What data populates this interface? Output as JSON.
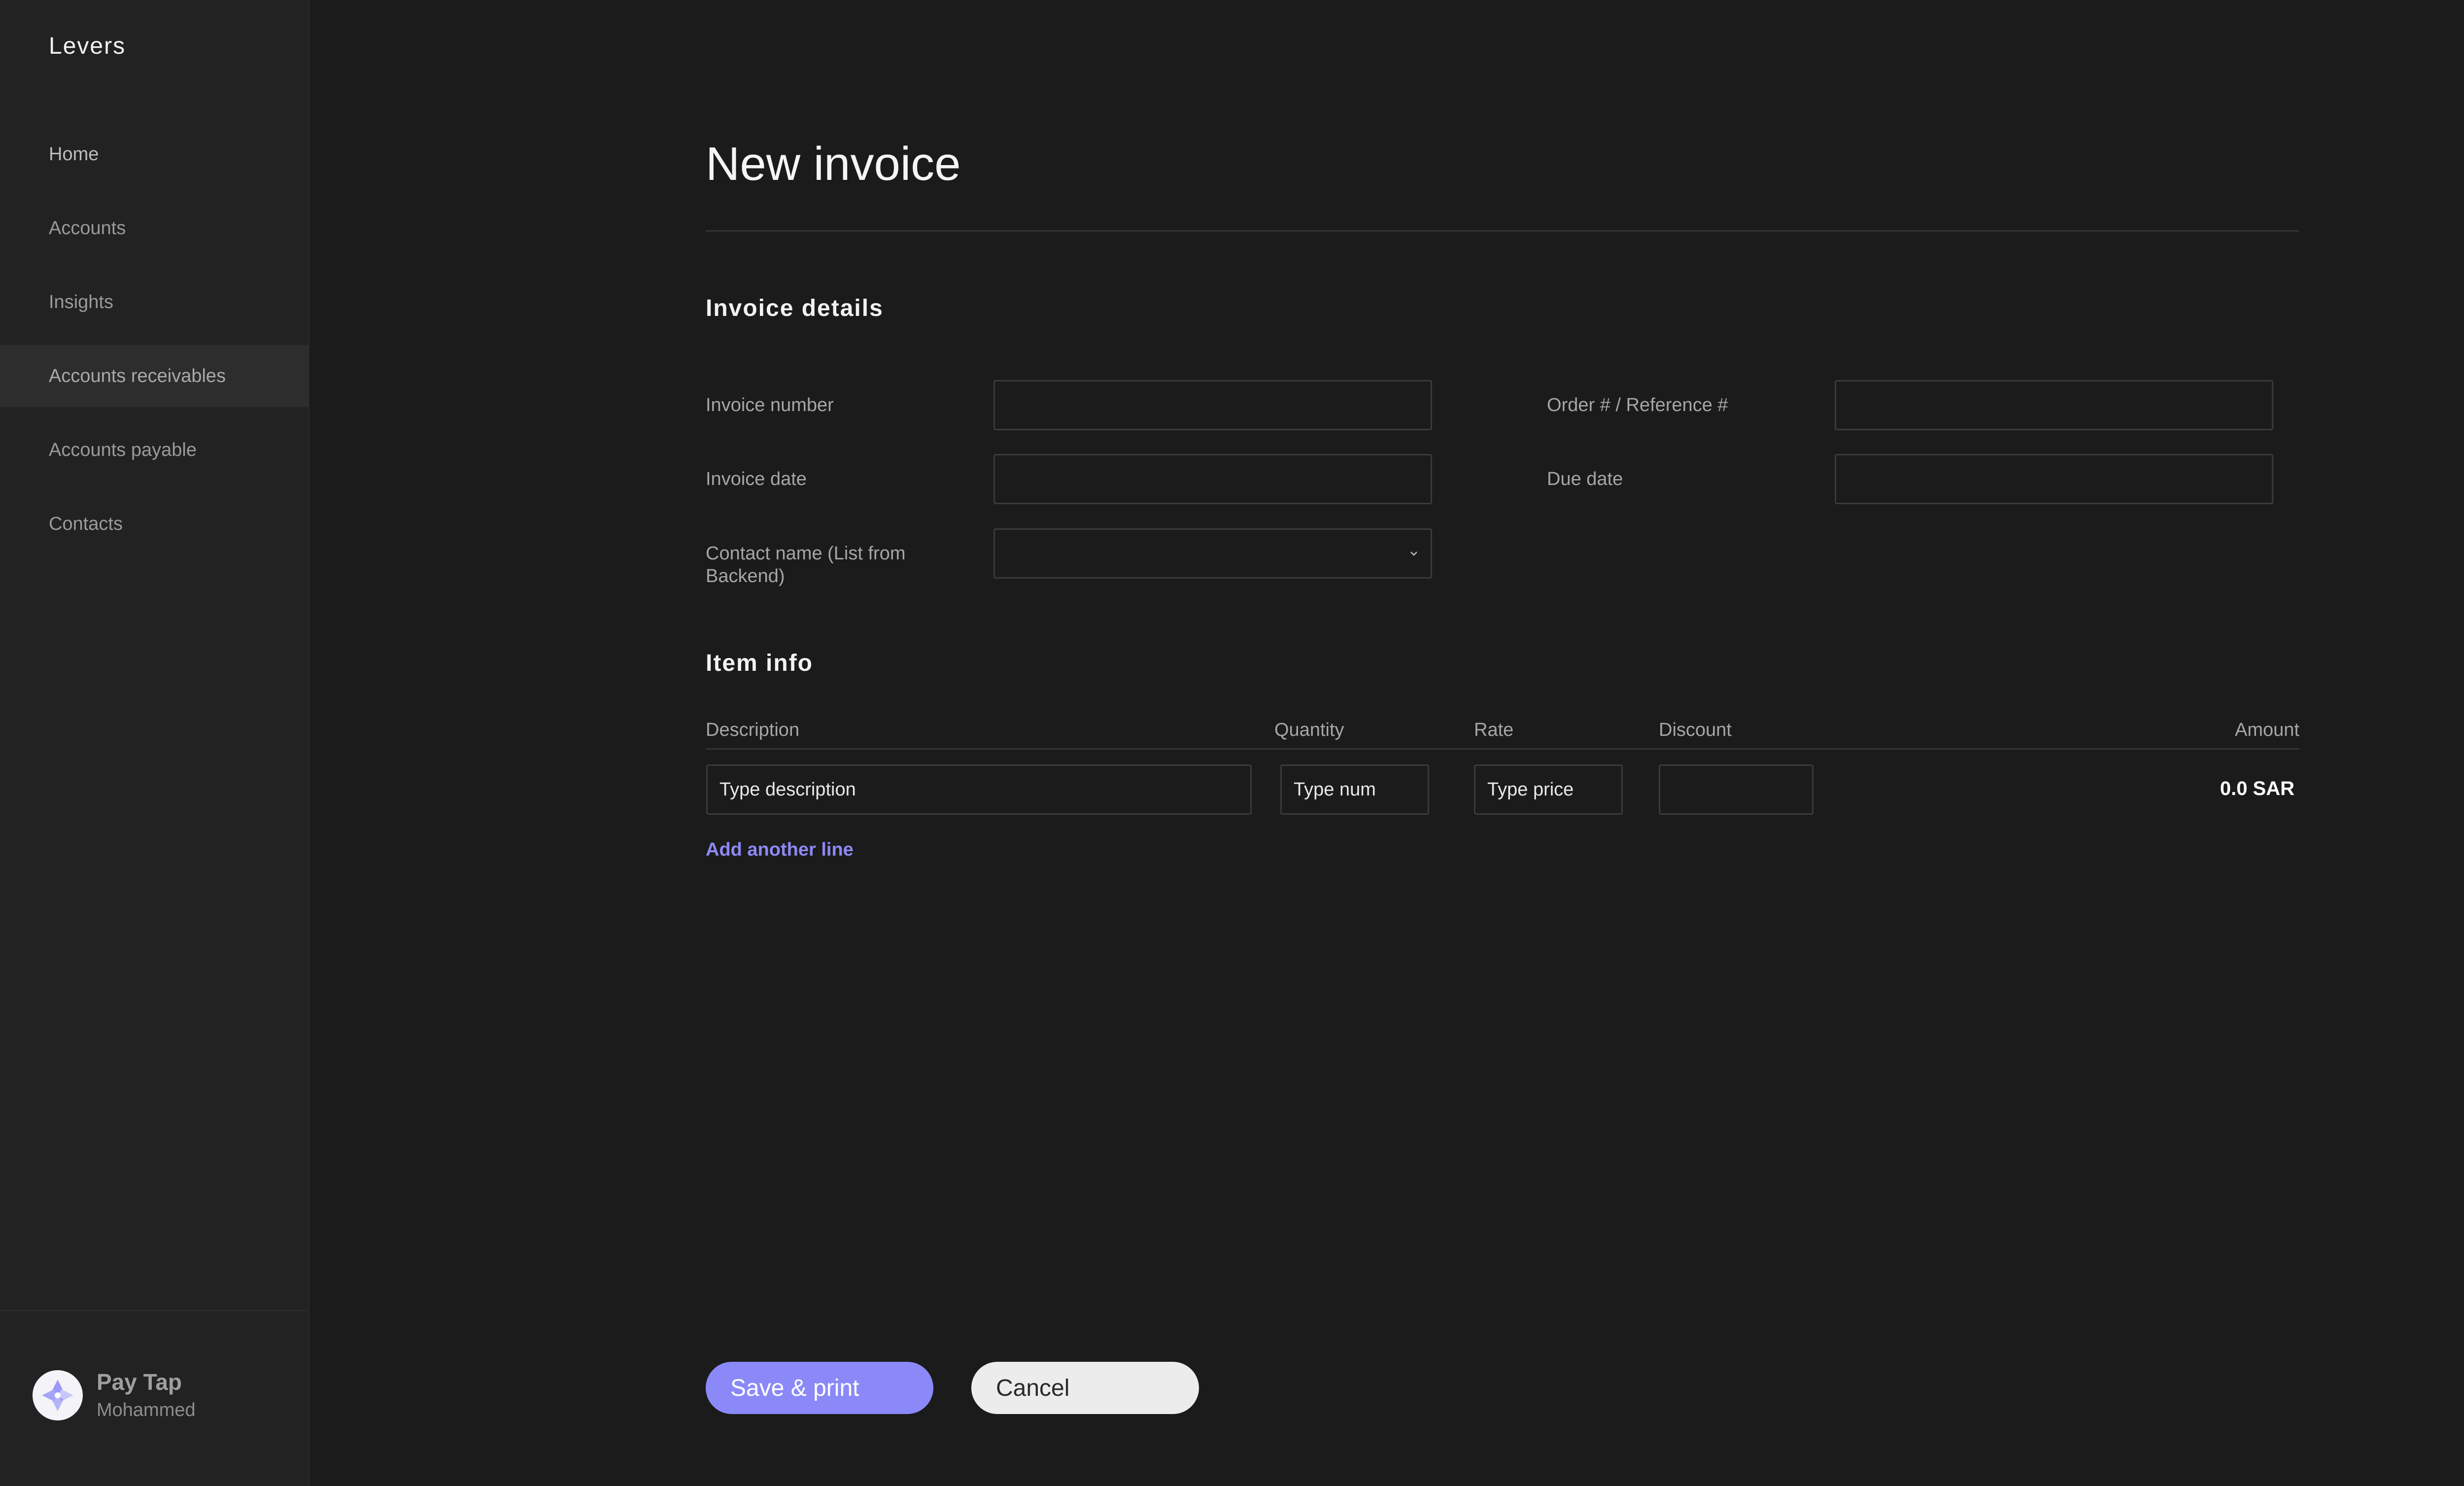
{
  "app": {
    "brand": "Levers"
  },
  "sidebar": {
    "items": [
      {
        "label": "Home"
      },
      {
        "label": "Accounts"
      },
      {
        "label": "Insights"
      },
      {
        "label": "Accounts receivables",
        "active": true
      },
      {
        "label": "Accounts payable"
      },
      {
        "label": "Contacts"
      }
    ],
    "profile": {
      "name": "Pay Tap",
      "subtitle": "Mohammed",
      "avatar_icon": "paytap-logo-icon"
    }
  },
  "page": {
    "title": "New invoice"
  },
  "invoice_details": {
    "heading": "Invoice details",
    "fields": {
      "invoice_number": {
        "label": "Invoice number",
        "value": ""
      },
      "order_reference": {
        "label": "Order # / Reference #",
        "value": ""
      },
      "invoice_date": {
        "label": "Invoice date",
        "value": ""
      },
      "due_date": {
        "label": "Due date",
        "value": ""
      },
      "contact_name": {
        "label": "Contact name (List from Backend)",
        "value": "",
        "icon": "chevron-down-icon"
      }
    }
  },
  "item_info": {
    "heading": "Item info",
    "columns": {
      "description": "Description",
      "quantity": "Quantity",
      "rate": "Rate",
      "discount": "Discount",
      "amount": "Amount"
    },
    "row": {
      "description_placeholder": "Type description",
      "quantity_placeholder": "Type num",
      "rate_placeholder": "Type price",
      "discount_value": "",
      "amount": "0.0 SAR"
    },
    "add_line_label": "Add another line"
  },
  "actions": {
    "save_label": "Save & print",
    "cancel_label": "Cancel"
  },
  "colors": {
    "accent": "#8b89f8",
    "background": "#1b1b1b",
    "sidebar": "#222222"
  }
}
